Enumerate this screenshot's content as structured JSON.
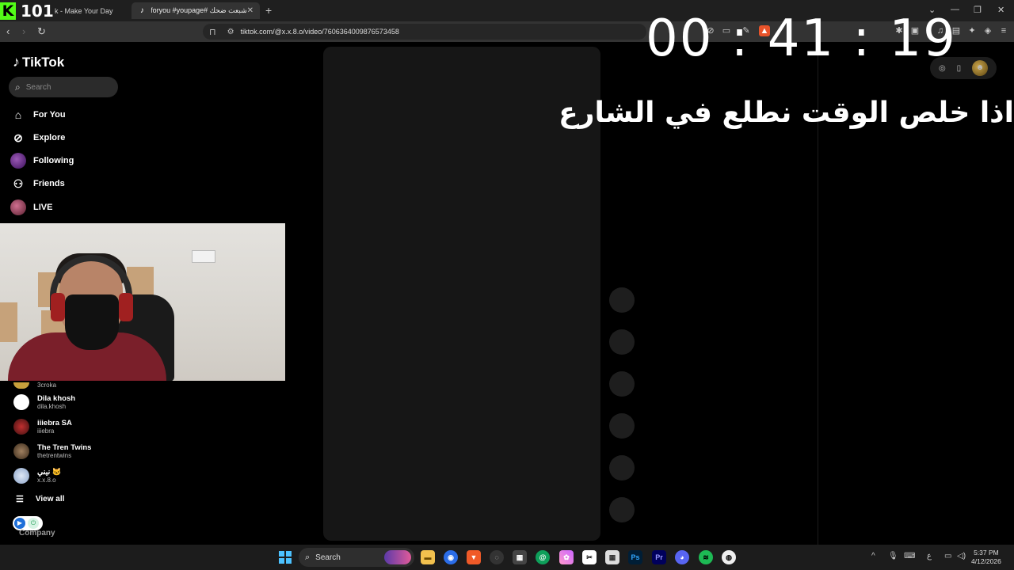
{
  "overlay": {
    "brand_letter": "K",
    "brand_number": "101",
    "timer": "00 : 41 : 19",
    "caption": "اذا خلص الوقت نطلع في الشارع"
  },
  "browser": {
    "tabs": [
      {
        "label": "k - Make Your Day",
        "icon": "tiktok-icon"
      },
      {
        "label": "شبعت ضحك #foryou #youpage",
        "icon": "tiktok-icon",
        "active": true
      }
    ],
    "url": "tiktok.com/@x.x.8.o/video/7606364009876573458"
  },
  "tiktok": {
    "logo": "TikTok",
    "search_placeholder": "Search",
    "nav": [
      {
        "label": "For You",
        "icon": "home-icon"
      },
      {
        "label": "Explore",
        "icon": "compass-icon"
      },
      {
        "label": "Following",
        "icon": "following-avatar-icon"
      },
      {
        "label": "Friends",
        "icon": "friends-icon"
      },
      {
        "label": "LIVE",
        "icon": "live-avatar-icon"
      }
    ],
    "following_accounts": [
      {
        "name": "",
        "handle": "3croka"
      },
      {
        "name": "Dila khosh",
        "handle": "dila.khosh"
      },
      {
        "name": "iiiebra SA",
        "handle": "iiiebra"
      },
      {
        "name": "The Tren Twins",
        "handle": "thetrentwins"
      },
      {
        "name": "نيني 🐱",
        "handle": "x.x.8.o"
      }
    ],
    "view_all": "View all",
    "company": "Company"
  },
  "taskbar": {
    "search_placeholder": "Search",
    "time": "5:37 PM",
    "date": "4/12/2026",
    "lang": "ع"
  },
  "colors": {
    "kick_green": "#53fc18",
    "background": "#000000",
    "video_panel": "#161616"
  }
}
